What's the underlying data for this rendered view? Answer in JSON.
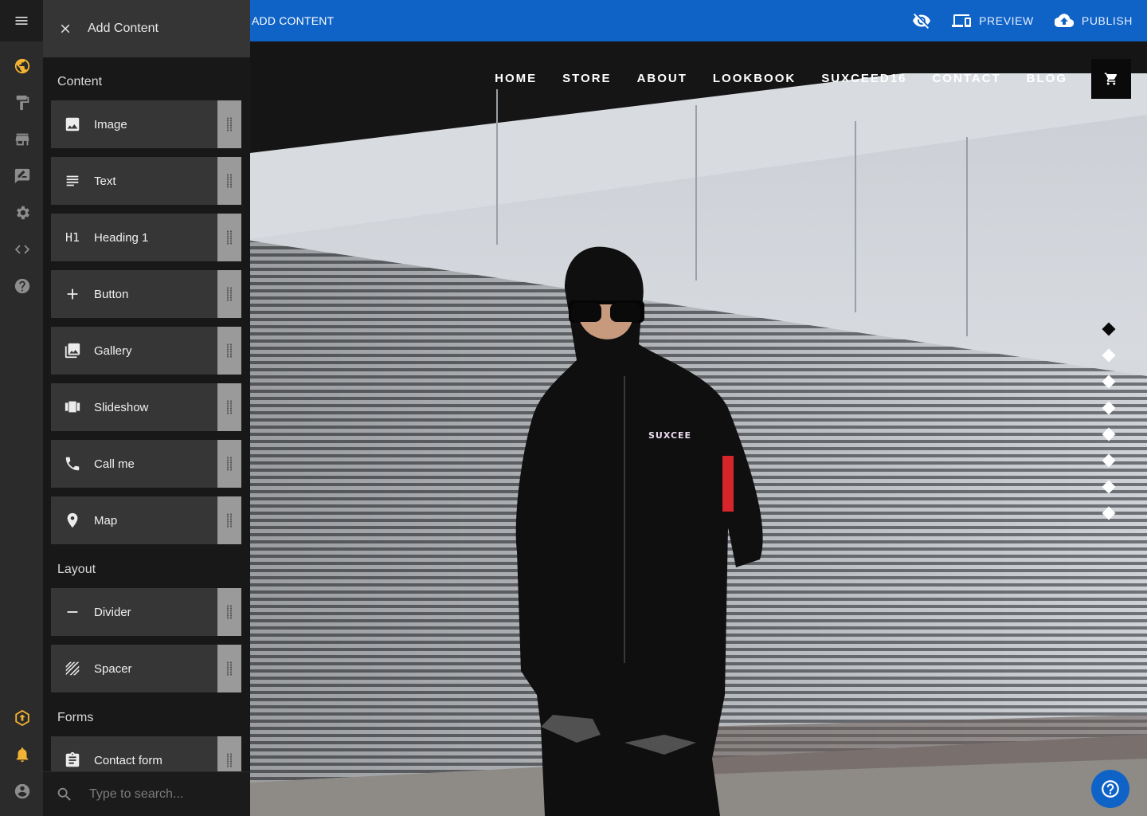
{
  "panel": {
    "title": "Add Content",
    "sections": {
      "content": "Content",
      "layout": "Layout",
      "forms": "Forms"
    },
    "content_items": [
      {
        "label": "Image",
        "icon": "image-icon"
      },
      {
        "label": "Text",
        "icon": "text-icon"
      },
      {
        "label": "Heading 1",
        "icon": "heading-icon",
        "glyph": "H1"
      },
      {
        "label": "Button",
        "icon": "plus-icon"
      },
      {
        "label": "Gallery",
        "icon": "gallery-icon"
      },
      {
        "label": "Slideshow",
        "icon": "slideshow-icon"
      },
      {
        "label": "Call me",
        "icon": "phone-icon"
      },
      {
        "label": "Map",
        "icon": "map-pin-icon"
      }
    ],
    "layout_items": [
      {
        "label": "Divider",
        "icon": "divider-icon"
      },
      {
        "label": "Spacer",
        "icon": "spacer-icon"
      }
    ],
    "form_items": [
      {
        "label": "Contact form",
        "icon": "clipboard-icon"
      }
    ],
    "search": {
      "placeholder": "Type to search..."
    }
  },
  "topbar": {
    "section_label": "ADD CONTENT",
    "preview_label": "PREVIEW",
    "publish_label": "PUBLISH",
    "color": "#0f63c7"
  },
  "site": {
    "nav": [
      "HOME",
      "STORE",
      "ABOUT",
      "LOOKBOOK",
      "SUXCEED16",
      "CONTACT",
      "BLOG"
    ],
    "slideshow": {
      "slide_count": 8,
      "active_index": 0
    }
  },
  "rail": {
    "accent": "#f2b233",
    "icons": [
      "menu-icon",
      "globe-icon",
      "paint-roller-icon",
      "store-icon",
      "edit-post-icon",
      "gear-icon",
      "code-icon",
      "help-icon",
      "upgrade-icon",
      "bell-icon",
      "account-icon"
    ]
  }
}
